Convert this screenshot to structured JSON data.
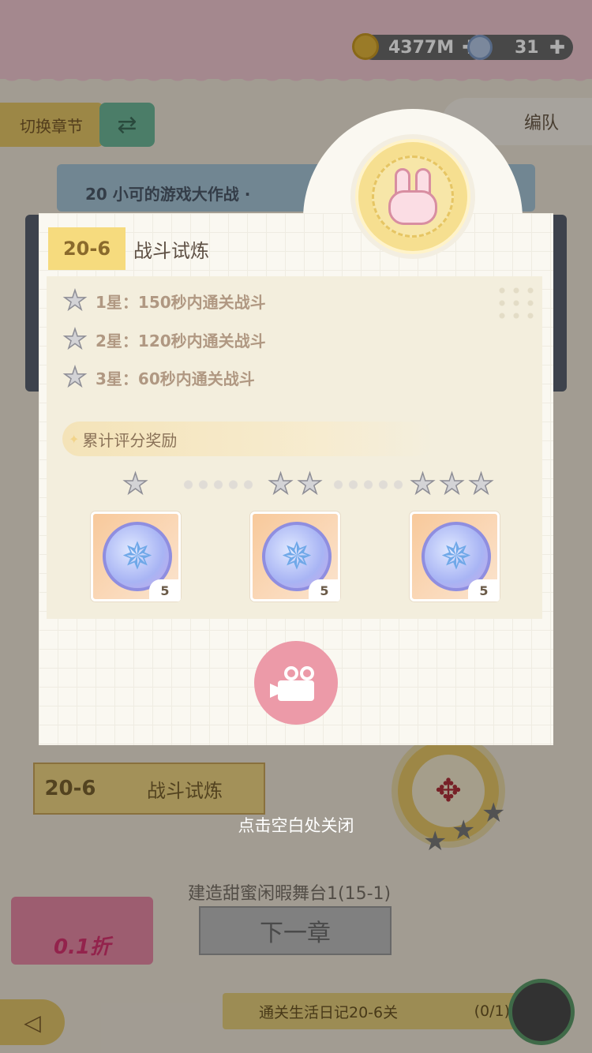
{
  "hud": {
    "coins": "4377M",
    "gems": "31",
    "plus": "✚"
  },
  "top": {
    "switch_chapter": "切换章节",
    "switch_icon": "⇄",
    "team": "编队"
  },
  "background": {
    "banner": "20 小可的游戏大作战 ·",
    "stage_num": "20-6",
    "stage_name": "战斗试炼",
    "build_text": "建造甜蜜闲暇舞台1(15-1)",
    "next_chapter": "下一章",
    "promo": "0.1折",
    "task": "通关生活日记20-6关",
    "task_count": "(0/1)",
    "back_icon": "◁"
  },
  "modal": {
    "stage_tag": "20-6",
    "title": "战斗试炼",
    "conditions": [
      {
        "star": "★",
        "text": "1星：150秒内通关战斗"
      },
      {
        "star": "★",
        "text": "2星：120秒内通关战斗"
      },
      {
        "star": "★",
        "text": "3星：60秒内通关战斗"
      }
    ],
    "reward_header": "累计评分奖励",
    "reward_spark": "✦",
    "tiers": [
      {
        "stars": 1,
        "qty": "5"
      },
      {
        "stars": 2,
        "qty": "5"
      },
      {
        "stars": 3,
        "qty": "5"
      }
    ],
    "star_glyph": "★",
    "gem_glyph": "✵"
  },
  "close_hint": "点击空白处关闭",
  "colors": {
    "accent": "#ec9aa8",
    "tag": "#f6db7e",
    "panel": "#faf8f1"
  }
}
